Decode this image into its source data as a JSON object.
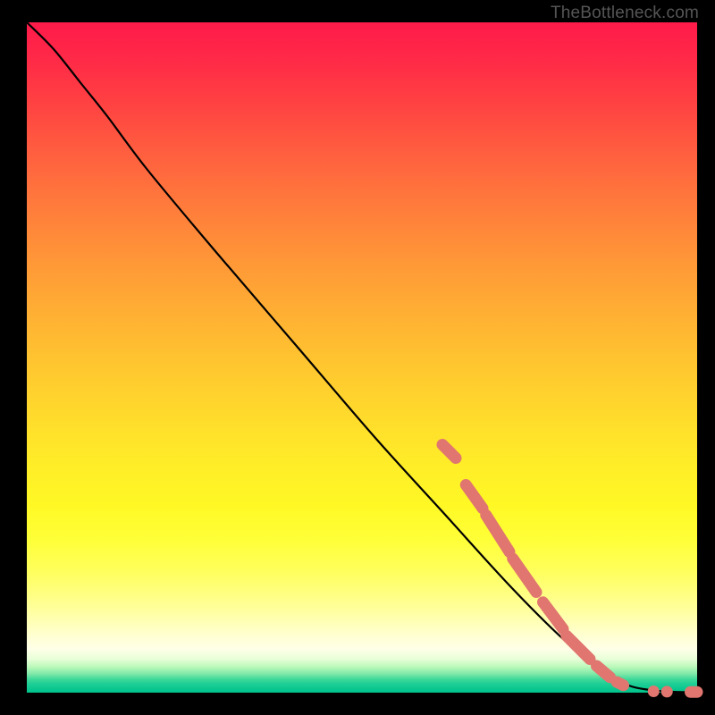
{
  "watermark": "TheBottleneck.com",
  "chart_data": {
    "type": "line",
    "title": "",
    "xlabel": "",
    "ylabel": "",
    "xlim": [
      0,
      100
    ],
    "ylim": [
      0,
      100
    ],
    "grid": false,
    "series": [
      {
        "name": "curve",
        "x": [
          0,
          4,
          8,
          12,
          18,
          28,
          40,
          52,
          62,
          72,
          80,
          86,
          90,
          93,
          95,
          97,
          100
        ],
        "y": [
          100,
          96,
          91,
          86,
          78,
          66,
          52,
          38,
          27,
          16,
          8,
          3,
          1,
          0.4,
          0.2,
          0.1,
          0.1
        ]
      }
    ],
    "markers": [
      {
        "x": 62,
        "y": 37,
        "segment": true,
        "end_x": 64,
        "end_y": 35
      },
      {
        "x": 65.5,
        "y": 31,
        "segment": true,
        "end_x": 68,
        "end_y": 27.5
      },
      {
        "x": 68.5,
        "y": 26.5,
        "segment": true,
        "end_x": 72,
        "end_y": 21
      },
      {
        "x": 72.5,
        "y": 20,
        "segment": true,
        "end_x": 76,
        "end_y": 15
      },
      {
        "x": 77,
        "y": 13.5,
        "segment": true,
        "end_x": 80,
        "end_y": 9.5
      },
      {
        "x": 80.5,
        "y": 8.5,
        "segment": true,
        "end_x": 84,
        "end_y": 5
      },
      {
        "x": 85,
        "y": 4,
        "segment": true,
        "end_x": 87,
        "end_y": 2.3
      },
      {
        "x": 88,
        "y": 1.6,
        "segment": true,
        "end_x": 89,
        "end_y": 1.1
      },
      {
        "x": 93.5,
        "y": 0.2,
        "segment": false
      },
      {
        "x": 95.5,
        "y": 0.15,
        "segment": false
      },
      {
        "x": 99,
        "y": 0.1,
        "segment": true,
        "end_x": 100,
        "end_y": 0.1
      }
    ],
    "colors": {
      "line": "#000000",
      "marker": "#e0766f"
    }
  }
}
